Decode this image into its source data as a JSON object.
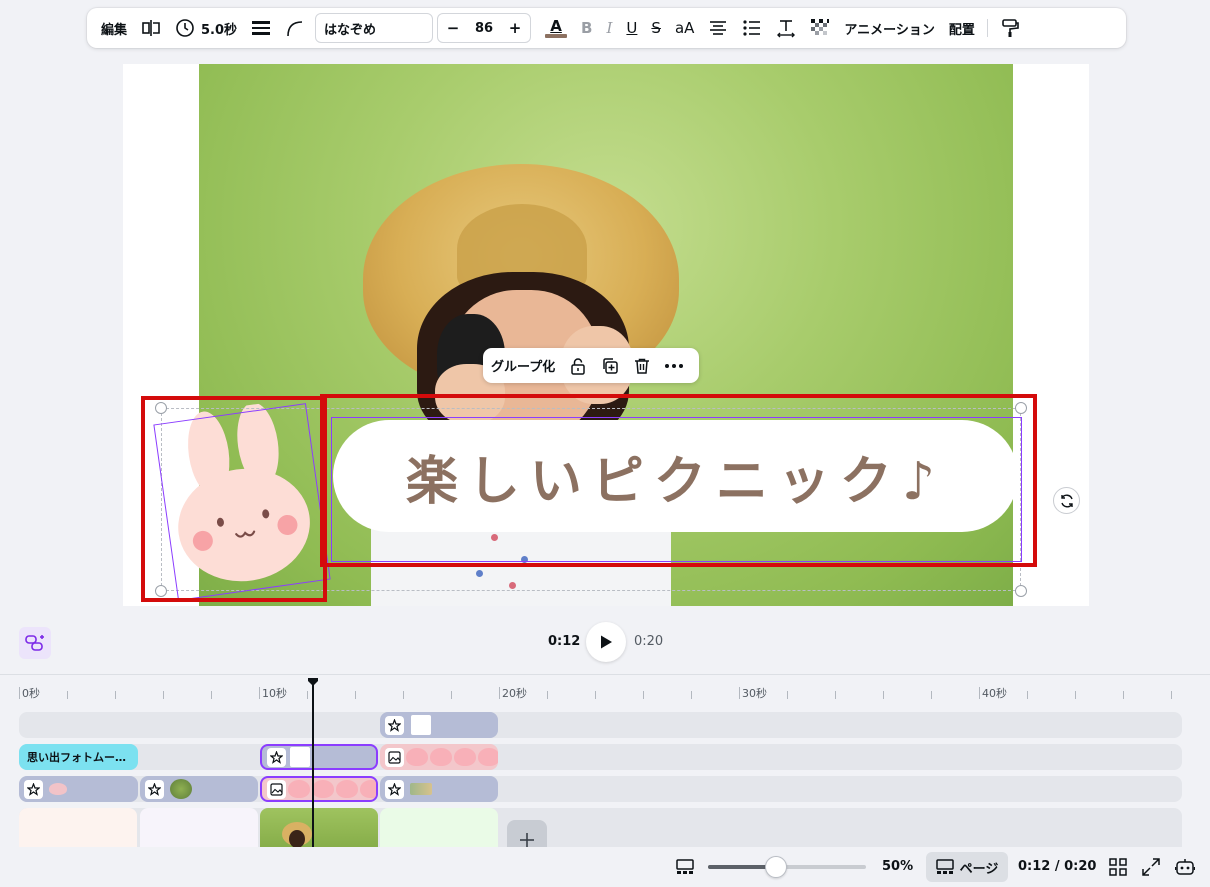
{
  "toolbar": {
    "edit_label": "編集",
    "duration_label": "5.0秒",
    "font_name": "はなぞめ",
    "font_size": "86",
    "minus": "−",
    "plus": "+",
    "letter_a": "A",
    "bold": "B",
    "italic": "I",
    "underline": "U",
    "strike": "S",
    "case": "aA",
    "animation_label": "アニメーション",
    "position_label": "配置"
  },
  "canvas": {
    "bubble_text": "楽しいピクニック♪"
  },
  "context_menu": {
    "group_label": "グループ化"
  },
  "playback": {
    "current_time": "0:12",
    "total_time": "0:20"
  },
  "timeline": {
    "ticks": [
      "0秒",
      "10秒",
      "20秒",
      "30秒",
      "40秒"
    ],
    "title_clip": "思い出フォトムー…"
  },
  "bottom_bar": {
    "zoom_value": "50%",
    "zoom_fraction": 0.43,
    "page_label": "ページ",
    "time_display": "0:12 / 0:20"
  },
  "colors": {
    "accent": "#8b3dff",
    "highlight": "#d40b0b",
    "text_brown": "#8c7161",
    "title_clip": "#7ce1f0"
  }
}
